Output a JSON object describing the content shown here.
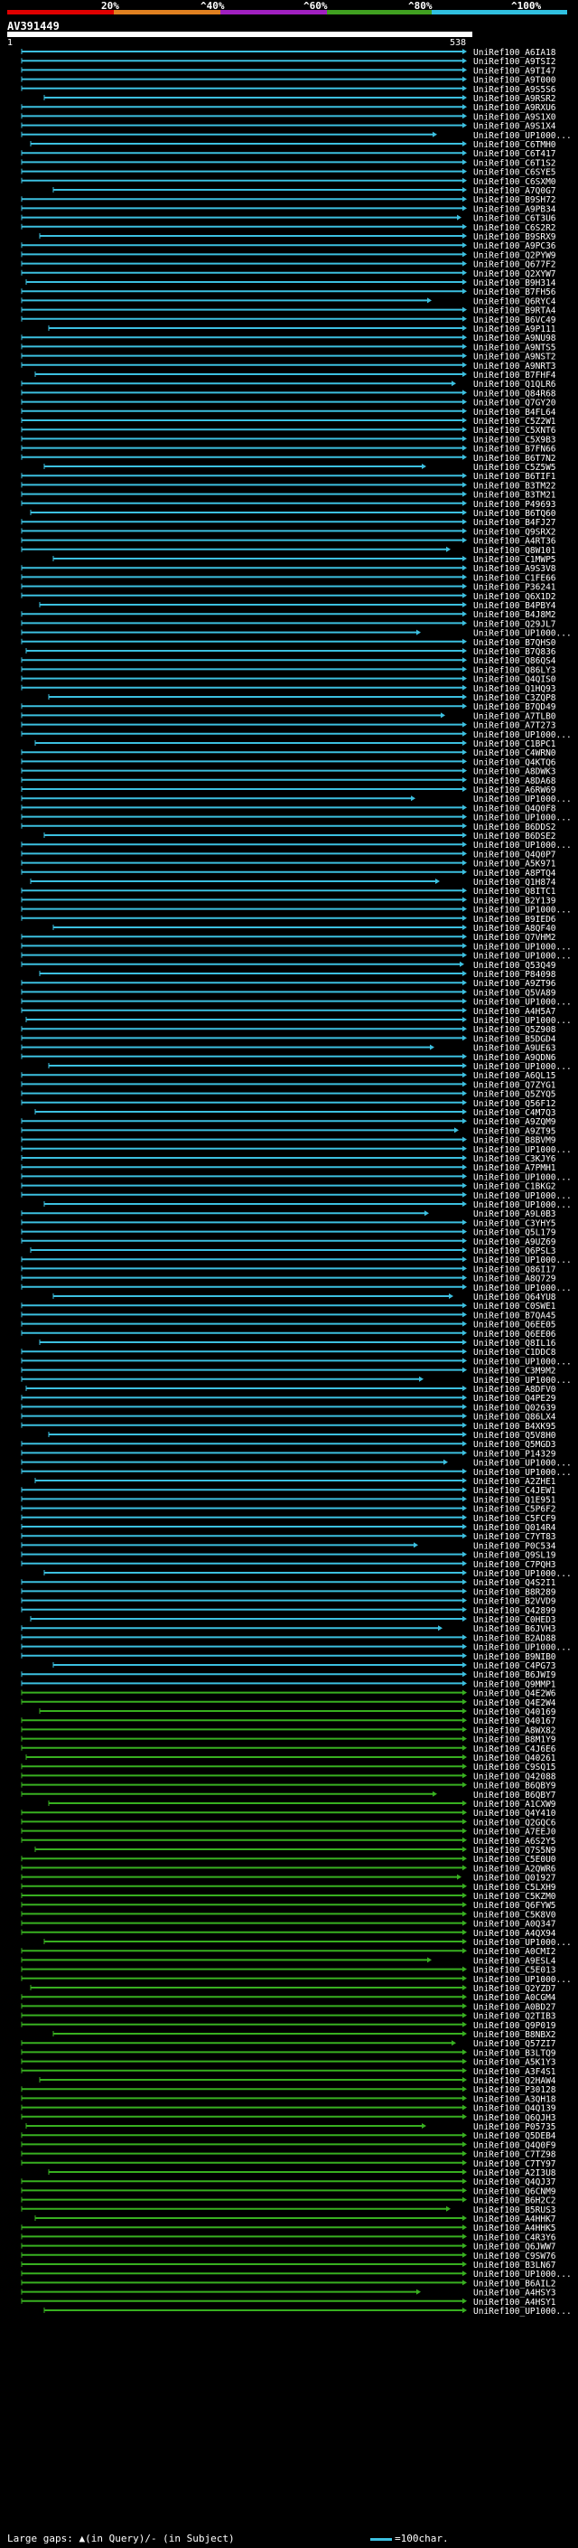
{
  "scale": {
    "ticks": [
      "20%",
      "^40%",
      "^60%",
      "^80%",
      "^100%"
    ],
    "bands": [
      "#e00000",
      "#e08020",
      "#a020c0",
      "#40a020",
      "#30c0e0"
    ]
  },
  "query": {
    "id": "AV391449",
    "start": "1",
    "end": "538"
  },
  "colors": {
    "blue": "#3cc0e0",
    "green": "#38b020",
    "bar": "#ffffff"
  },
  "hits": [
    "UniRef100_A6IA18",
    "UniRef100_A9TSI2",
    "UniRef100_A9TI47",
    "UniRef100_A9T000",
    "UniRef100_A9S5S6",
    "UniRef100_A9RSR2",
    "UniRef100_A9RXU6",
    "UniRef100_A9S1X0",
    "UniRef100_A9S1X4",
    "UniRef100_UP1000...",
    "UniRef100_C6TMH0",
    "UniRef100_C6T417",
    "UniRef100_C6T1S2",
    "UniRef100_C6SYE5",
    "UniRef100_C6SXM0",
    "UniRef100_A7Q0G7",
    "UniRef100_B9SH72",
    "UniRef100_A9PB34",
    "UniRef100_C6T3U6",
    "UniRef100_C6S2R2",
    "UniRef100_B9SRX9",
    "UniRef100_A9PC36",
    "UniRef100_Q2PYW9",
    "UniRef100_Q677F2",
    "UniRef100_Q2XYW7",
    "UniRef100_B9H314",
    "UniRef100_B7FH56",
    "UniRef100_Q6RYC4",
    "UniRef100_B9RTA4",
    "UniRef100_B6VC49",
    "UniRef100_A9P111",
    "UniRef100_A9NU98",
    "UniRef100_A9NTS5",
    "UniRef100_A9NST2",
    "UniRef100_A9NRT3",
    "UniRef100_B7FHF4",
    "UniRef100_Q1QLR6",
    "UniRef100_Q84R68",
    "UniRef100_Q7GY20",
    "UniRef100_B4FL64",
    "UniRef100_C5Z2W1",
    "UniRef100_C5XNT6",
    "UniRef100_C5X9B3",
    "UniRef100_B7FN66",
    "UniRef100_B6T7N2",
    "UniRef100_C5Z5W5",
    "UniRef100_B6TIF1",
    "UniRef100_B3TM22",
    "UniRef100_B3TM21",
    "UniRef100_P49693",
    "UniRef100_B6TQ60",
    "UniRef100_B4FJ27",
    "UniRef100_Q9SRX2",
    "UniRef100_A4RT36",
    "UniRef100_Q8W101",
    "UniRef100_C1MWP5",
    "UniRef100_A9S3V8",
    "UniRef100_C1FE66",
    "UniRef100_P36241",
    "UniRef100_Q6X1D2",
    "UniRef100_B4PBY4",
    "UniRef100_B4J8M2",
    "UniRef100_Q29JL7",
    "UniRef100_UP1000...",
    "UniRef100_B7QHS0",
    "UniRef100_B7Q836",
    "UniRef100_Q86QS4",
    "UniRef100_Q86LY3",
    "UniRef100_Q4QIS0",
    "UniRef100_Q1HQ93",
    "UniRef100_C3ZQP8",
    "UniRef100_B7QD49",
    "UniRef100_A7TLB0",
    "UniRef100_A7T273",
    "UniRef100_UP1000...",
    "UniRef100_C1BPC1",
    "UniRef100_C4WRN0",
    "UniRef100_Q4KTQ6",
    "UniRef100_A8DWK3",
    "UniRef100_A8DA68",
    "UniRef100_A6RW69",
    "UniRef100_UP1000...",
    "UniRef100_Q4Q0F8",
    "UniRef100_UP1000...",
    "UniRef100_B6DDS2",
    "UniRef100_B6DSE2",
    "UniRef100_UP1000...",
    "UniRef100_Q4Q0P7",
    "UniRef100_A5K971",
    "UniRef100_A8PTQ4",
    "UniRef100_Q1H874",
    "UniRef100_Q8ITC1",
    "UniRef100_B2Y139",
    "UniRef100_UP1000...",
    "UniRef100_B9IED6",
    "UniRef100_A8QF40",
    "UniRef100_Q7VHM2",
    "UniRef100_UP1000...",
    "UniRef100_UP1000...",
    "UniRef100_Q53Q49",
    "UniRef100_P84098",
    "UniRef100_A9ZT96",
    "UniRef100_Q5VA89",
    "UniRef100_UP1000...",
    "UniRef100_A4H5A7",
    "UniRef100_UP1000...",
    "UniRef100_Q5Z908",
    "UniRef100_B5DGD4",
    "UniRef100_A9UE63",
    "UniRef100_A9QDN6",
    "UniRef100_UP1000...",
    "UniRef100_A6QL15",
    "UniRef100_Q7ZYG1",
    "UniRef100_Q5ZYQ5",
    "UniRef100_Q56F12",
    "UniRef100_C4M7Q3",
    "UniRef100_A9ZQM9",
    "UniRef100_A9ZT95",
    "UniRef100_B8BVM9",
    "UniRef100_UP1000...",
    "UniRef100_C3KJY6",
    "UniRef100_A7PMH1",
    "UniRef100_UP1000...",
    "UniRef100_C1BKG2",
    "UniRef100_UP1000...",
    "UniRef100_UP1000...",
    "UniRef100_A9L0B3",
    "UniRef100_C3YHY5",
    "UniRef100_Q5L179",
    "UniRef100_A9UZ69",
    "UniRef100_Q6PSL3",
    "UniRef100_UP1000...",
    "UniRef100_Q86I17",
    "UniRef100_A8Q729",
    "UniRef100_UP1000...",
    "UniRef100_Q64YU8",
    "UniRef100_C0SWE1",
    "UniRef100_B7QA45",
    "UniRef100_Q6EE05",
    "UniRef100_Q6EE06",
    "UniRef100_Q8IL16",
    "UniRef100_C1DDC8",
    "UniRef100_UP1000...",
    "UniRef100_C3M9M2",
    "UniRef100_UP1000...",
    "UniRef100_A8DFV0",
    "UniRef100_Q4PE29",
    "UniRef100_Q02639",
    "UniRef100_Q86LX4",
    "UniRef100_B4XK95",
    "UniRef100_Q5V8H0",
    "UniRef100_Q5MGD3",
    "UniRef100_P14329",
    "UniRef100_UP1000...",
    "UniRef100_UP1000...",
    "UniRef100_A2ZHE1",
    "UniRef100_C4JEW1",
    "UniRef100_Q1E951",
    "UniRef100_C5P6F2",
    "UniRef100_C5FCF9",
    "UniRef100_Q014R4",
    "UniRef100_C7YT83",
    "UniRef100_P0C534",
    "UniRef100_Q9SL19",
    "UniRef100_C7PQH3",
    "UniRef100_UP1000...",
    "UniRef100_Q4S2I1",
    "UniRef100_B8R289",
    "UniRef100_B2VVD9",
    "UniRef100_Q42899",
    "UniRef100_C0HED3",
    "UniRef100_B6JVH3",
    "UniRef100_B2AD88",
    "UniRef100_UP1000...",
    "UniRef100_B9NIB0",
    "UniRef100_C4PG73",
    "UniRef100_B6JWI9",
    "UniRef100_Q9MMP1",
    "UniRef100_Q4E2W6",
    "UniRef100_Q4E2W4",
    "UniRef100_Q40169",
    "UniRef100_Q40167",
    "UniRef100_A8WX82",
    "UniRef100_B8M1Y9",
    "UniRef100_C4J6E6",
    "UniRef100_Q40261",
    "UniRef100_C9SQ15",
    "UniRef100_Q42088",
    "UniRef100_B6QBY9",
    "UniRef100_B6QBY7",
    "UniRef100_A1CXW9",
    "UniRef100_Q4Y410",
    "UniRef100_Q2GQC6",
    "UniRef100_A7EEJ0",
    "UniRef100_A6S2Y5",
    "UniRef100_Q7S5N9",
    "UniRef100_C5E0U0",
    "UniRef100_A2QWR6",
    "UniRef100_Q01927",
    "UniRef100_C5LXH9",
    "UniRef100_C5KZM0",
    "UniRef100_Q6FYW5",
    "UniRef100_C5K8V0",
    "UniRef100_A0Q347",
    "UniRef100_A4QX94",
    "UniRef100_UP1000...",
    "UniRef100_A0CMI2",
    "UniRef100_A9ESL4",
    "UniRef100_C5E013",
    "UniRef100_UP1000...",
    "UniRef100_Q2YZD7",
    "UniRef100_A0CGM4",
    "UniRef100_A0BD27",
    "UniRef100_Q2TIB3",
    "UniRef100_Q9P019",
    "UniRef100_B8NBX2",
    "UniRef100_Q57ZI7",
    "UniRef100_B3LTQ9",
    "UniRef100_A5K1Y3",
    "UniRef100_A3F4S1",
    "UniRef100_Q2HAW4",
    "UniRef100_P30128",
    "UniRef100_A3QH18",
    "UniRef100_Q4Q139",
    "UniRef100_Q6QJH3",
    "UniRef100_P05735",
    "UniRef100_Q5DEB4",
    "UniRef100_Q4Q0F9",
    "UniRef100_C7TZ98",
    "UniRef100_C7TY97",
    "UniRef100_A2I3U8",
    "UniRef100_Q4QJ37",
    "UniRef100_Q6CNM9",
    "UniRef100_B6H2C2",
    "UniRef100_B5RUS3",
    "UniRef100_A4HHK7",
    "UniRef100_A4HHK5",
    "UniRef100_C4R3Y6",
    "UniRef100_Q6JWW7",
    "UniRef100_C9SW76",
    "UniRef100_B3LN67",
    "UniRef100_UP1000...",
    "UniRef100_B6AIL2",
    "UniRef100_A4HSY3",
    "UniRef100_A4HSY1",
    "UniRef100_UP1000..."
  ],
  "footer": {
    "left": "Large gaps: ▲(in Query)/- (in Subject)",
    "right": "=100char."
  }
}
